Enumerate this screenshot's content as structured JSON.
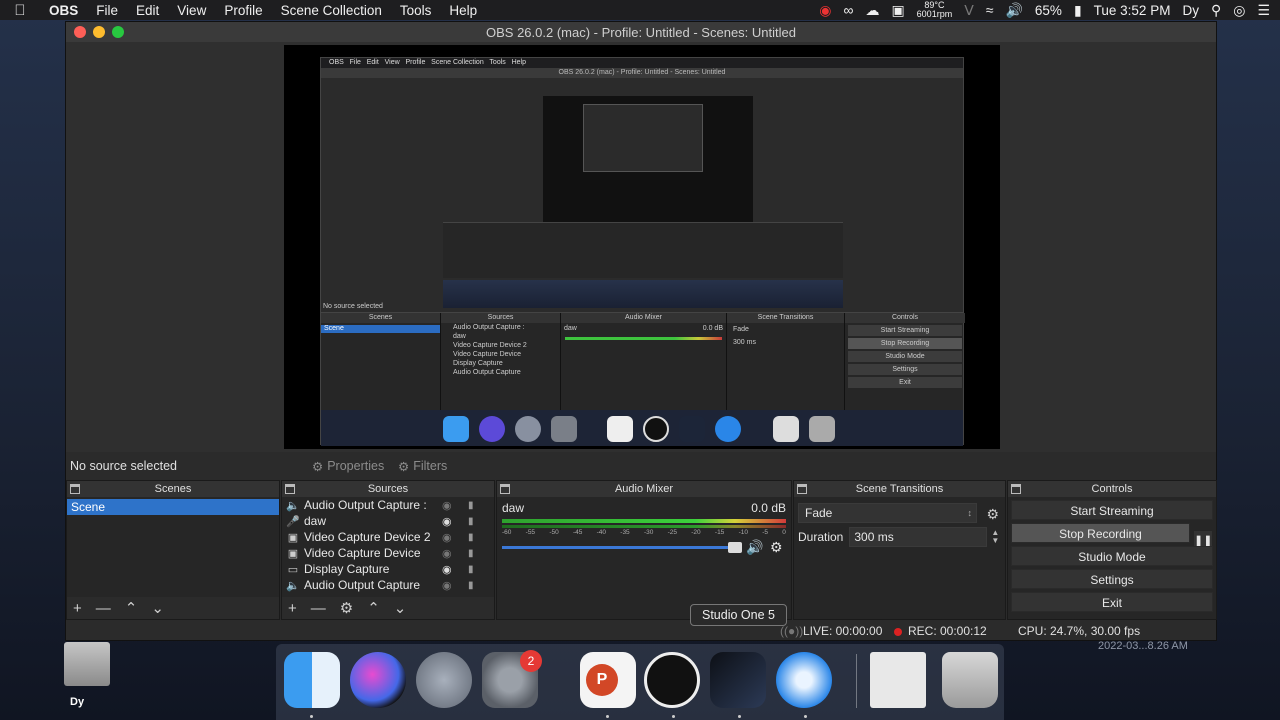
{
  "menubar": {
    "app_name": "OBS",
    "items": [
      "File",
      "Edit",
      "View",
      "Profile",
      "Scene Collection",
      "Tools",
      "Help"
    ],
    "temp": "89°C",
    "fan": "6001rpm",
    "battery": "65%",
    "clock": "Tue 3:52 PM",
    "user": "Dy"
  },
  "window": {
    "title": "OBS 26.0.2 (mac) - Profile: Untitled - Scenes: Untitled"
  },
  "toolbar": {
    "no_source": "No source selected",
    "properties": "Properties",
    "filters": "Filters"
  },
  "scenes": {
    "header": "Scenes",
    "items": [
      "Scene"
    ]
  },
  "sources": {
    "header": "Sources",
    "items": [
      {
        "name": "Audio Output Capture :",
        "icon": "speaker-icon",
        "visible": false
      },
      {
        "name": "daw",
        "icon": "microphone-icon",
        "visible": true
      },
      {
        "name": "Video Capture Device 2",
        "icon": "camera-icon",
        "visible": false
      },
      {
        "name": "Video Capture Device",
        "icon": "camera-icon",
        "visible": false
      },
      {
        "name": "Display Capture",
        "icon": "monitor-icon",
        "visible": true
      },
      {
        "name": "Audio Output Capture",
        "icon": "speaker-icon",
        "visible": false
      }
    ]
  },
  "mixer": {
    "header": "Audio Mixer",
    "channel": "daw",
    "level": "0.0 dB",
    "ticks": [
      "-60",
      "-55",
      "-50",
      "-45",
      "-40",
      "-35",
      "-30",
      "-25",
      "-20",
      "-15",
      "-10",
      "-5",
      "0"
    ]
  },
  "transitions": {
    "header": "Scene Transitions",
    "selected": "Fade",
    "duration_label": "Duration",
    "duration_value": "300 ms"
  },
  "controls": {
    "header": "Controls",
    "start_streaming": "Start Streaming",
    "stop_recording": "Stop Recording",
    "studio_mode": "Studio Mode",
    "settings": "Settings",
    "exit": "Exit"
  },
  "status": {
    "live": "LIVE: 00:00:00",
    "rec": "REC: 00:00:12",
    "cpu": "CPU: 24.7%, 30.00 fps"
  },
  "tooltip": "Studio One 5",
  "desktop": {
    "hd_label": "Dy",
    "screenshot_label": "2022-03...8.26 AM",
    "prefs_badge": "2"
  }
}
